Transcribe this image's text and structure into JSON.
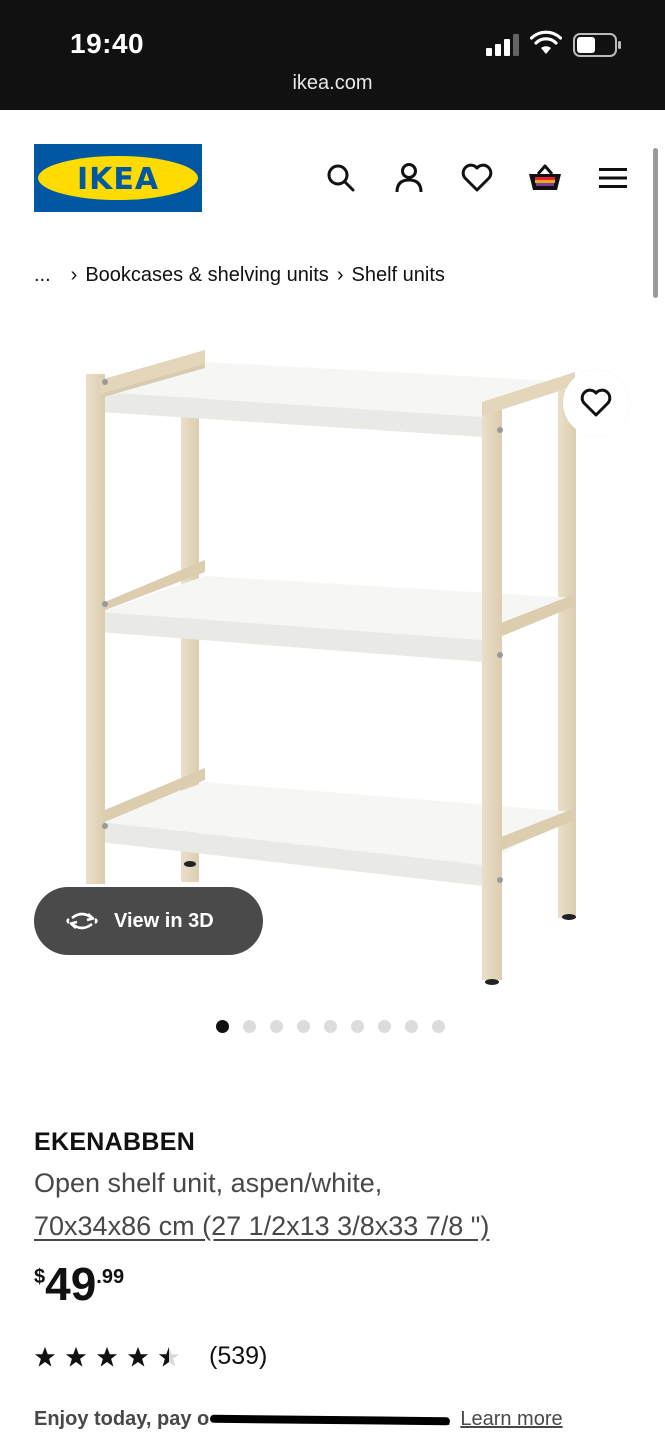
{
  "status_bar": {
    "time": "19:40",
    "url": "ikea.com",
    "icons": [
      "signal-icon",
      "wifi-icon",
      "battery-icon"
    ]
  },
  "header": {
    "logo_text": "IKEA",
    "icons": [
      "search-icon",
      "account-icon",
      "heart-icon",
      "cart-icon",
      "menu-icon"
    ]
  },
  "breadcrumb": {
    "ellipsis": "...",
    "items": [
      "Bookcases & shelving units",
      "Shelf units"
    ]
  },
  "gallery": {
    "view_3d_label": "View in 3D",
    "dot_count": 9,
    "active_index": 0
  },
  "product": {
    "name": "EKENABBEN",
    "description": "Open shelf unit, aspen/white,",
    "dimensions": "70x34x86 cm (27 1/2x13 3/8x33 7/8 \")",
    "price_currency": "$",
    "price_main": "49",
    "price_decimal": ".99",
    "rating": 4.5,
    "rating_count": "(539)"
  },
  "afterpay": {
    "text": "Enjoy today, pay over time with Afterpay.",
    "visible_prefix": "Enjoy today, pay o",
    "link": "Learn more"
  },
  "colors": {
    "brand_blue": "#0058a3",
    "brand_yellow": "#ffdb00",
    "status_bar": "#111111",
    "view3d_button": "#4a4a4a"
  }
}
